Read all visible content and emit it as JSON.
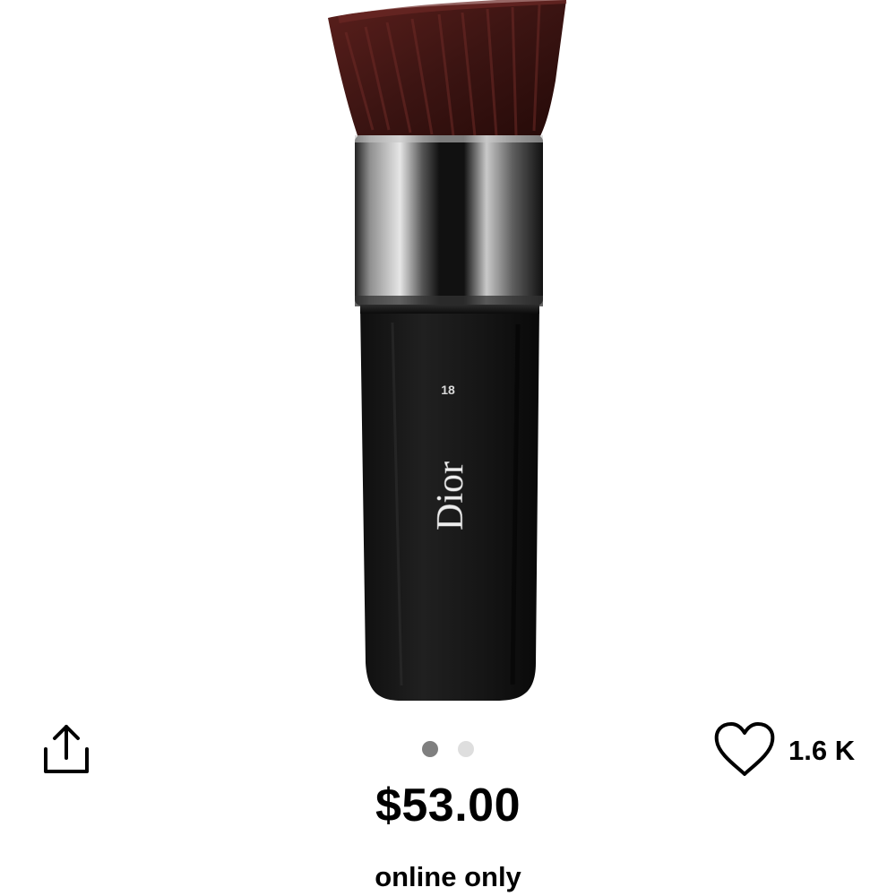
{
  "product": {
    "image_icon": "angled-makeup-brush-image",
    "brand_mark": "Dior",
    "brush_number": "18",
    "price": "$53.00",
    "availability": "online only"
  },
  "carousel": {
    "total": 2,
    "active_index": 0
  },
  "actions": {
    "share_icon": "share-icon",
    "love_icon": "heart-outline-icon",
    "love_count": "1.6 K"
  },
  "colors": {
    "background": "#ffffff",
    "text": "#000000",
    "dot_active": "#7f7f7f",
    "dot_inactive": "#dedede"
  }
}
